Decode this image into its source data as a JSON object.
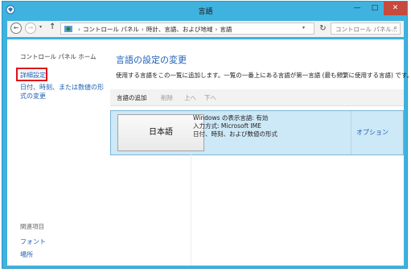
{
  "window": {
    "title": "言語"
  },
  "address": {
    "crumbs": [
      "コントロール パネル",
      "時計、言語、および地域",
      "言語"
    ],
    "search_placeholder": "コントロール パネル..."
  },
  "sidebar": {
    "home": "コントロール パネル ホーム",
    "advanced": "詳細設定",
    "date_format": "日付、時刻、または数値の形式の変更",
    "related_heading": "関連項目",
    "fonts": "フォント",
    "location": "場所"
  },
  "main": {
    "title": "言語の設定の変更",
    "description": "使用する言語をこの一覧に追加します。一覧の一番上にある言語が第一言語 (最も頻繁に使用する言語) です。",
    "toolbar": {
      "add": "言語の追加",
      "remove": "削除",
      "up": "上へ",
      "down": "下へ"
    },
    "languages": [
      {
        "name": "日本語",
        "details": [
          "Windows の表示言語: 有効",
          "入力方式: Microsoft IME",
          "日付、時刻、および数値の形式"
        ],
        "options": "オプション"
      }
    ]
  },
  "colors": {
    "accent": "#3fb2df",
    "link": "#1e5fb4",
    "highlight_box": "#e0101a",
    "selected_row": "#cde8f6"
  }
}
